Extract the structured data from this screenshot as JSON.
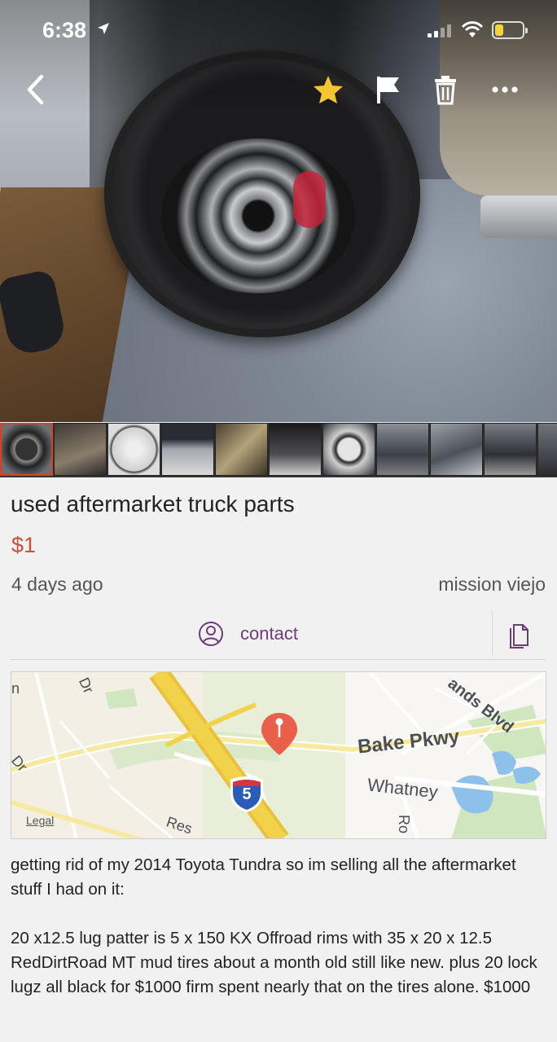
{
  "status_bar": {
    "time": "6:38",
    "battery_level": 0.3,
    "battery_color": "#f5d33b"
  },
  "nav": {
    "back_icon": "chevron-left-icon",
    "star_icon": "star-icon",
    "star_color": "#f5c532",
    "flag_icon": "flag-icon",
    "trash_icon": "trash-icon",
    "more_icon": "ellipsis-icon"
  },
  "gallery": {
    "selected_index": 0,
    "thumbnail_count": 11,
    "selected_border_color": "#d9402a"
  },
  "listing": {
    "title": "used aftermarket truck parts",
    "price": "$1",
    "posted": "4 days ago",
    "location": "mission viejo",
    "price_color": "#c9513b"
  },
  "actions": {
    "contact_label": "contact",
    "contact_color": "#6b3d7a",
    "contact_icon": "user-icon",
    "copy_icon": "copy-icon"
  },
  "map": {
    "labels": {
      "bake_pkwy": "Bake Pkwy",
      "whatney": "Whatney",
      "lands_blvd": "ands Blvd",
      "dr_top": "Dr",
      "dr_left": "Dr",
      "res": "Res",
      "ro": "Ro",
      "n": "n"
    },
    "highway_shield": "5",
    "legal": "Legal",
    "pin_color": "#e8604a"
  },
  "description": "getting rid of my 2014 Toyota Tundra so im selling all the aftermarket stuff I had on it:\n\n20 x12.5 lug patter is 5 x 150 KX Offroad rims with 35 x 20 x 12.5 RedDirtRoad MT mud tires about a month old still like new. plus 20 lock lugz all black for $1000 firm spent nearly that on the tires alone. $1000"
}
